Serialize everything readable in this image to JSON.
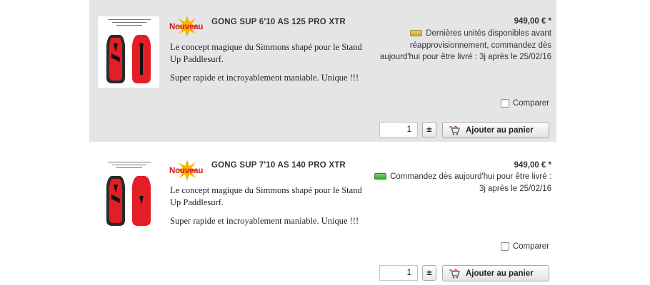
{
  "products": [
    {
      "badge": "Nouveau",
      "title": "GONG SUP 6'10 AS 125 PRO XTR",
      "description": [
        "Le concept magique du Simmons shapé pour le Stand Up Paddlesurf.",
        "Super rapide et incroyablement maniable. Unique !!!"
      ],
      "price": "949,00 € *",
      "stock_status": "limited",
      "stock_icon": "stock-limited-icon",
      "delivery_text": "Dernières unités disponibles avant réapprovisionnement, commandez dès aujourd'hui pour être livré : 3j après le 25/02/16",
      "compare_label": "Comparer",
      "quantity": "1",
      "stepper_label": "±",
      "add_to_cart_label": "Ajouter au panier",
      "highlighted": true
    },
    {
      "badge": "Nouveau",
      "title": "GONG SUP 7'10 AS 140 PRO XTR",
      "description": [
        "Le concept magique du Simmons shapé pour le Stand Up Paddlesurf.",
        "Super rapide et incroyablement maniable. Unique !!!"
      ],
      "price": "949,00 € *",
      "stock_status": "available",
      "stock_icon": "stock-available-icon",
      "delivery_text": "Commandez dès aujourd'hui pour être livré : 3j après le 25/02/16",
      "compare_label": "Comparer",
      "quantity": "1",
      "stepper_label": "±",
      "add_to_cart_label": "Ajouter au panier",
      "highlighted": false
    }
  ],
  "colors": {
    "highlight_bg": "#e5e5e5",
    "badge_red": "#d8141e",
    "badge_star": "#f6b400",
    "board_red": "#e41e25",
    "stock_limited": "#d4b545",
    "stock_available": "#45b03a"
  }
}
